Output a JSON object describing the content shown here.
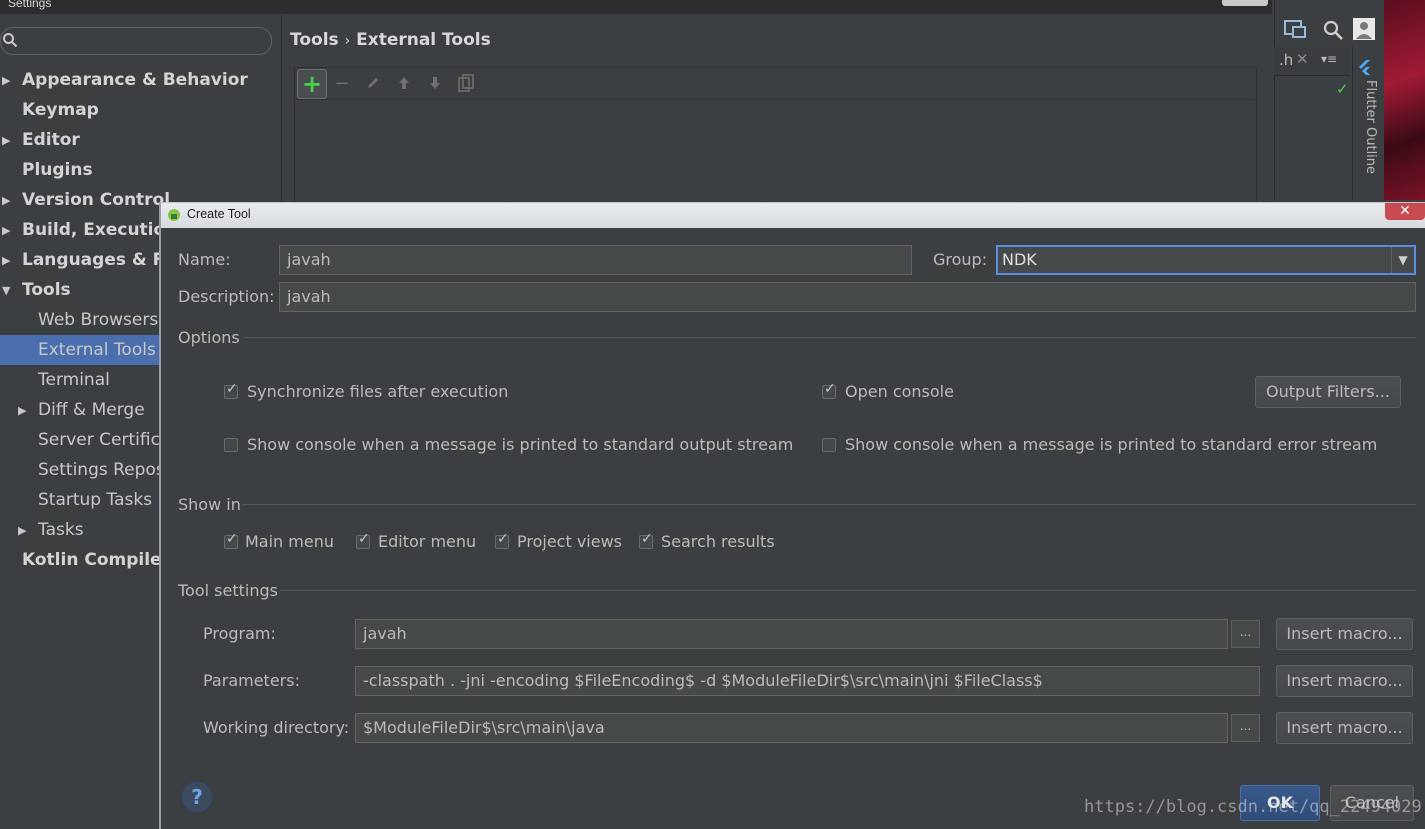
{
  "settings": {
    "window_title": "Settings",
    "breadcrumb": {
      "parent": "Tools",
      "separator": "›",
      "current": "External Tools"
    },
    "sidebar": {
      "items": [
        {
          "label": "Appearance & Behavior",
          "bold": true,
          "arrow": "right"
        },
        {
          "label": "Keymap",
          "bold": true,
          "arrow": "none"
        },
        {
          "label": "Editor",
          "bold": true,
          "arrow": "right"
        },
        {
          "label": "Plugins",
          "bold": true,
          "arrow": "none"
        },
        {
          "label": "Version Control",
          "bold": true,
          "arrow": "right"
        },
        {
          "label": "Build, Execution,",
          "bold": true,
          "arrow": "right"
        },
        {
          "label": "Languages & Fra",
          "bold": true,
          "arrow": "right"
        },
        {
          "label": "Tools",
          "bold": true,
          "arrow": "down"
        },
        {
          "label": "Web Browsers",
          "bold": false,
          "arrow": "none"
        },
        {
          "label": "External Tools",
          "bold": false,
          "arrow": "none",
          "selected": true
        },
        {
          "label": "Terminal",
          "bold": false,
          "arrow": "none"
        },
        {
          "label": "Diff & Merge",
          "bold": false,
          "arrow": "right"
        },
        {
          "label": "Server Certificat",
          "bold": false,
          "arrow": "none"
        },
        {
          "label": "Settings Reposit",
          "bold": false,
          "arrow": "none"
        },
        {
          "label": "Startup Tasks",
          "bold": false,
          "arrow": "none"
        },
        {
          "label": "Tasks",
          "bold": false,
          "arrow": "right"
        },
        {
          "label": "Kotlin Compiler",
          "bold": true,
          "arrow": "none"
        }
      ]
    }
  },
  "ide": {
    "tab_label": ".h",
    "side_panel_label": "Flutter Outline"
  },
  "dialog": {
    "title": "Create Tool",
    "name_label": "Name:",
    "name_value": "javah",
    "group_label": "Group:",
    "group_value": "NDK",
    "description_label": "Description:",
    "description_value": "javah",
    "options_header": "Options",
    "options": {
      "sync_files": {
        "label": "Synchronize files after execution",
        "checked": true
      },
      "open_console": {
        "label": "Open console",
        "checked": true
      },
      "show_console_stdout": {
        "label": "Show console when a message is printed to standard output stream",
        "checked": false
      },
      "show_console_stderr": {
        "label": "Show console when a message is printed to standard error stream",
        "checked": false
      }
    },
    "output_filters_button": "Output Filters...",
    "show_in_header": "Show in",
    "show_in": [
      {
        "label": "Main menu",
        "checked": true
      },
      {
        "label": "Editor menu",
        "checked": true
      },
      {
        "label": "Project views",
        "checked": true
      },
      {
        "label": "Search results",
        "checked": true
      }
    ],
    "tool_settings_header": "Tool settings",
    "program_label": "Program:",
    "program_value": "javah",
    "parameters_label": "Parameters:",
    "parameters_value": "-classpath . -jni -encoding $FileEncoding$ -d $ModuleFileDir$\\src\\main\\jni $FileClass$",
    "working_dir_label": "Working directory:",
    "working_dir_value": "$ModuleFileDir$\\src\\main\\java",
    "insert_macro_button": "Insert macro...",
    "ellipsis": "...",
    "ok_button": "OK",
    "cancel_button": "Cancel",
    "help_symbol": "?"
  },
  "watermark": "https://blog.csdn.net/qq_22494029",
  "colors": {
    "accent_blue": "#4b6eaf",
    "focus_border": "#5b8de0",
    "add_green": "#4bd04b"
  }
}
